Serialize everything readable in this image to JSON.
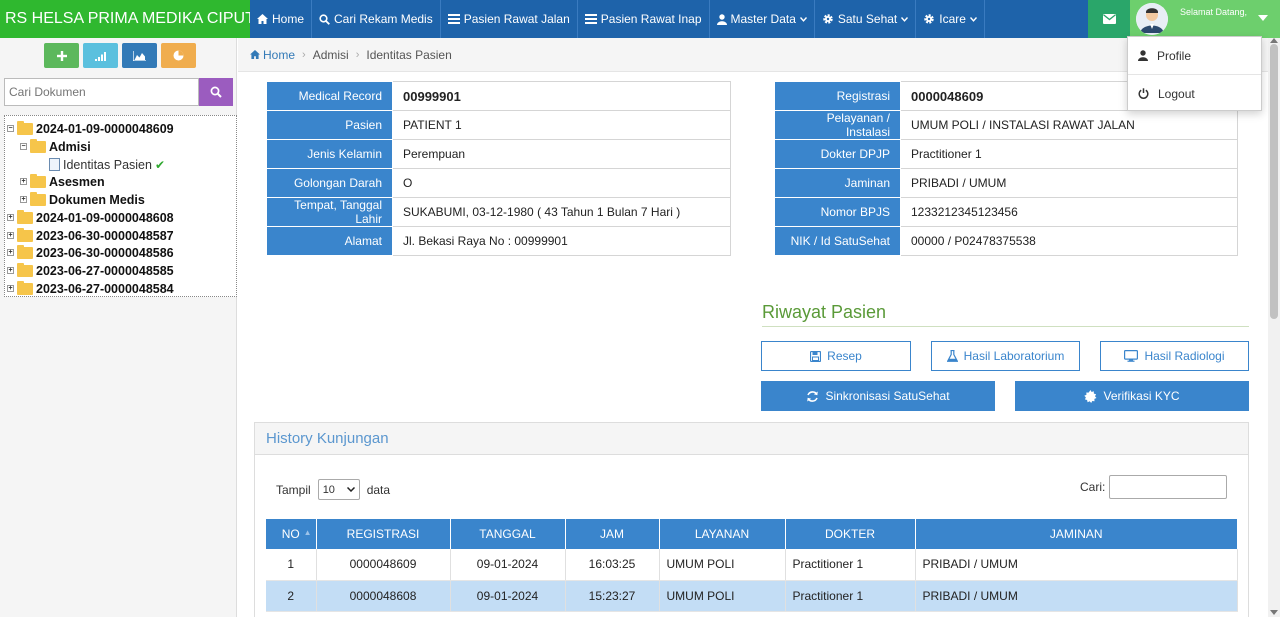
{
  "navbar": {
    "brand": "RS HELSA PRIMA MEDIKA CIPUTAT",
    "items": [
      {
        "label": "Home",
        "icon": "home-icon"
      },
      {
        "label": "Cari Rekam Medis",
        "icon": "search-icon"
      },
      {
        "label": "Pasien Rawat Jalan",
        "icon": "list-icon"
      },
      {
        "label": "Pasien Rawat Inap",
        "icon": "list-icon"
      },
      {
        "label": "Master Data",
        "icon": "user-icon"
      },
      {
        "label": "Satu Sehat",
        "icon": "gear-icon"
      },
      {
        "label": "Icare",
        "icon": "gear-icon"
      }
    ],
    "greeting": "Selamat Datang,"
  },
  "user_menu": {
    "profile": "Profile",
    "logout": "Logout"
  },
  "sidebar": {
    "search_placeholder": "Cari Dokumen",
    "tree": {
      "root_1": "2024-01-09-0000048609",
      "admisi": "Admisi",
      "identitas": "Identitas Pasien",
      "asesmen": "Asesmen",
      "dokumen": "Dokumen Medis",
      "root_2": "2024-01-09-0000048608",
      "root_3": "2023-06-30-0000048587",
      "root_4": "2023-06-30-0000048586",
      "root_5": "2023-06-27-0000048585",
      "root_6": "2023-06-27-0000048584"
    }
  },
  "breadcrumb": {
    "home": "Home",
    "admisi": "Admisi",
    "current": "Identitas Pasien"
  },
  "patient": {
    "left": [
      {
        "label": "Medical Record",
        "value": "00999901"
      },
      {
        "label": "Pasien",
        "value": "PATIENT 1"
      },
      {
        "label": "Jenis Kelamin",
        "value": "Perempuan"
      },
      {
        "label": "Golongan Darah",
        "value": "O"
      },
      {
        "label": "Tempat, Tanggal Lahir",
        "value": "SUKABUMI, 03-12-1980 ( 43 Tahun 1 Bulan 7 Hari )"
      },
      {
        "label": "Alamat",
        "value": "Jl. Bekasi Raya No : 00999901"
      }
    ],
    "right": [
      {
        "label": "Registrasi",
        "value": "0000048609"
      },
      {
        "label": "Pelayanan / Instalasi",
        "value": "UMUM POLI / INSTALASI RAWAT JALAN"
      },
      {
        "label": "Dokter DPJP",
        "value": "Practitioner 1"
      },
      {
        "label": "Jaminan",
        "value": "PRIBADI / UMUM"
      },
      {
        "label": "Nomor BPJS",
        "value": "1233212345123456"
      },
      {
        "label": "NIK / Id SatuSehat",
        "value": "00000 / P02478375538"
      }
    ]
  },
  "riwayat": {
    "title": "Riwayat Pasien",
    "resep": "Resep",
    "lab": "Hasil Laboratorium",
    "radiologi": "Hasil Radiologi",
    "sinkron": "Sinkronisasi SatuSehat",
    "kyc": "Verifikasi KYC"
  },
  "history": {
    "title": "History Kunjungan",
    "show_label": "Tampil",
    "page_size": "10",
    "entries_label": "data",
    "search_label": "Cari:",
    "columns": [
      "NO",
      "REGISTRASI",
      "TANGGAL",
      "JAM",
      "LAYANAN",
      "DOKTER",
      "JAMINAN"
    ],
    "rows": [
      [
        "1",
        "0000048609",
        "09-01-2024",
        "16:03:25",
        "UMUM POLI",
        "Practitioner 1",
        "PRIBADI / UMUM"
      ],
      [
        "2",
        "0000048608",
        "09-01-2024",
        "15:23:27",
        "UMUM POLI",
        "Practitioner 1",
        "PRIBADI / UMUM"
      ]
    ]
  },
  "colors": {
    "navbar": "#1e63aa",
    "brand": "#2fb82f",
    "accent": "#3a85cc",
    "riwayat_title": "#5a9a38"
  }
}
